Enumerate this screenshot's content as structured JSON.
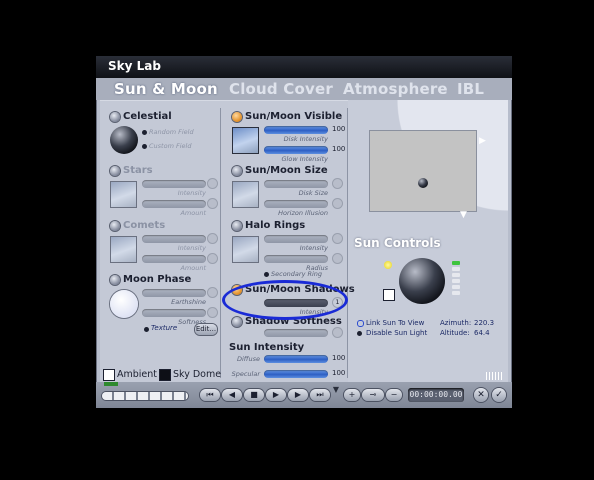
{
  "window": {
    "title": "Sky Lab"
  },
  "tabs": [
    {
      "label": "Sun & Moon",
      "active": true
    },
    {
      "label": "Cloud Cover",
      "active": false
    },
    {
      "label": "Atmosphere",
      "active": false
    },
    {
      "label": "IBL",
      "active": false
    }
  ],
  "left": {
    "celestial": {
      "label": "Celestial",
      "random_field": "Random Field",
      "custom_field": "Custom Field"
    },
    "stars": {
      "label": "Stars",
      "intensity": "Intensity",
      "amount": "Amount"
    },
    "comets": {
      "label": "Comets",
      "intensity": "Intensity",
      "amount": "Amount"
    },
    "moon_phase": {
      "label": "Moon Phase",
      "earthshine": "Earthshine",
      "softness": "Softness",
      "texture": "Texture",
      "edit": "Edit..."
    },
    "ambient": "Ambient",
    "sky_dome": "Sky Dome"
  },
  "middle": {
    "visible": {
      "label": "Sun/Moon Visible",
      "disk_intensity": "Disk Intensity",
      "disk_intensity_value": "100",
      "glow_intensity": "Glow Intensity",
      "glow_intensity_value": "100"
    },
    "size": {
      "label": "Sun/Moon Size",
      "disk_size": "Disk Size",
      "horizon_illusion": "Horizon Illusion"
    },
    "halo": {
      "label": "Halo Rings",
      "intensity": "Intensity",
      "radius": "Radius",
      "secondary_ring": "Secondary Ring"
    },
    "shadows": {
      "label": "Sun/Moon Shadows",
      "intensity": "Intensity",
      "value": "1"
    },
    "shadow_softness": {
      "label": "Shadow Softness"
    },
    "sun_intensity": {
      "label": "Sun Intensity",
      "diffuse": "Diffuse",
      "diffuse_value": "100",
      "specular": "Specular",
      "specular_value": "100"
    }
  },
  "right": {
    "sun_controls": "Sun Controls",
    "link_sun_to_view": "Link Sun To View",
    "disable_sun_light": "Disable Sun Light",
    "azimuth_label": "Azimuth:",
    "azimuth_value": "220.3",
    "altitude_label": "Altitude:",
    "altitude_value": "64.4"
  },
  "playback": {
    "time": "00:00:00.00"
  },
  "colors": {
    "highlight_circle": "#1a2bd6",
    "accent_orange": "#e08a1e"
  }
}
